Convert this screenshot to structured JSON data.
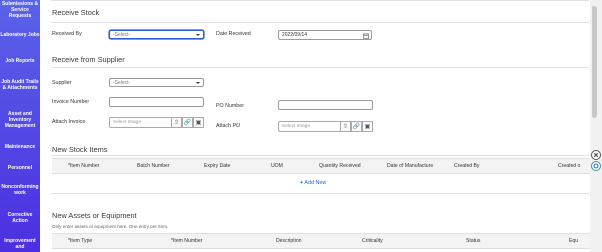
{
  "sidebar": {
    "items": [
      {
        "label": "Submissions & Service Requests"
      },
      {
        "label": "Laboratory Jobs"
      },
      {
        "label": "Job Reports"
      },
      {
        "label": "Job Audit Trails & Attachments"
      },
      {
        "label": "Asset and Inventory Management"
      },
      {
        "label": "Maintenance"
      },
      {
        "label": "Personnel"
      },
      {
        "label": "Nonconforming work"
      },
      {
        "label": "Corrective Action"
      },
      {
        "label": "Improvement and"
      }
    ]
  },
  "receive_stock": {
    "title": "Receive Stock",
    "received_by_label": "Received By",
    "received_by_value": "-Select-",
    "date_received_label": "Date Received",
    "date_received_value": "2022/09/14"
  },
  "receive_supplier": {
    "title": "Receive from Supplier",
    "supplier_label": "Supplier",
    "supplier_value": "-Select-",
    "invoice_number_label": "Invoice Number",
    "po_number_label": "PO Number",
    "attach_invoice_label": "Attach Invoice",
    "attach_invoice_placeholder": "Select Image",
    "attach_po_label": "Attach PO",
    "attach_po_placeholder": "Select Image"
  },
  "stock_items": {
    "title": "New Stock Items",
    "columns": [
      "*Item Number",
      "Batch Number",
      "Expiry Date",
      "UOM",
      "Quantity Received",
      "Date of Manufacture",
      "Created By",
      "Created o"
    ],
    "add_new_label": "Add New"
  },
  "assets": {
    "title": "New Assets or Equipment",
    "note": "Only enter assets or equipment here. One entry per item.",
    "columns": [
      "*Item Type",
      "*Item Number",
      "Description",
      "Criticality",
      "Status",
      "Equ"
    ]
  },
  "colors": {
    "sidebar_top": "#5a63e8",
    "sidebar_bottom": "#4b2fe0",
    "accent": "#2b5ed8"
  }
}
